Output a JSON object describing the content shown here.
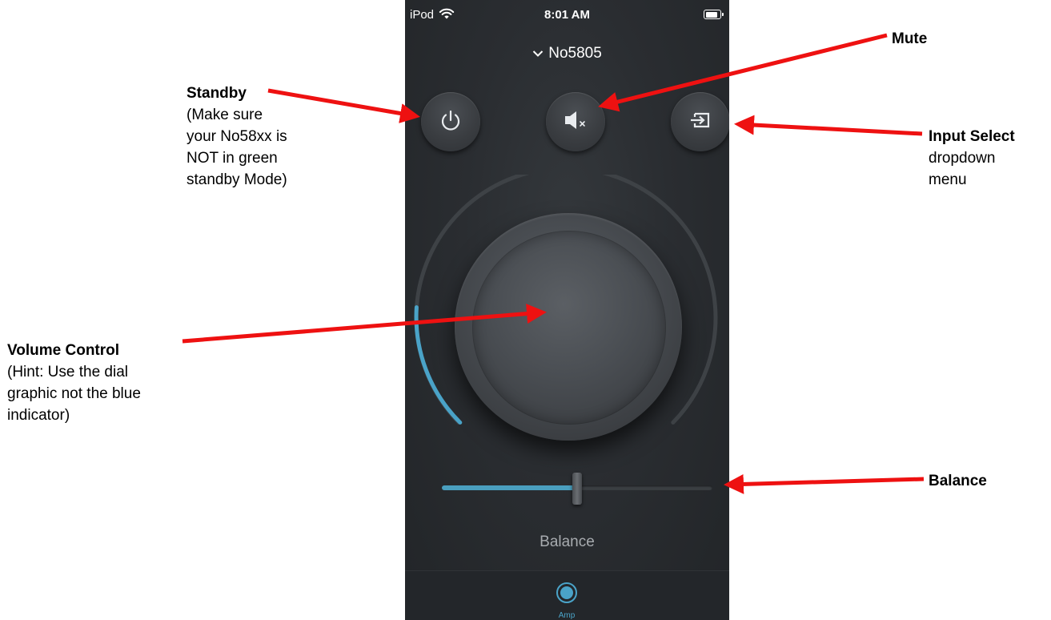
{
  "status_bar": {
    "carrier": "iPod",
    "time": "8:01 AM"
  },
  "device": {
    "title": "No5805"
  },
  "controls": {
    "standby_icon": "power-icon",
    "mute_icon": "speaker-mute-icon",
    "input_icon": "input-select-icon"
  },
  "volume": {
    "level": 0.18
  },
  "balance": {
    "label": "Balance",
    "position": 0.5
  },
  "tabbar": {
    "amp_label": "Amp"
  },
  "colors": {
    "accent": "#4aa3c8",
    "annotation_arrow": "#ee1111"
  },
  "annotations": {
    "standby": {
      "title": "Standby",
      "lines": [
        "(Make sure",
        "your No58xx is",
        "NOT in green",
        "standby Mode)"
      ]
    },
    "volume": {
      "title": "Volume Control",
      "lines": [
        "(Hint: Use the dial",
        "graphic not the blue",
        "indicator)"
      ]
    },
    "mute": {
      "title": "Mute"
    },
    "input": {
      "title": "Input Select",
      "lines": [
        "dropdown",
        "menu"
      ]
    },
    "balance": {
      "title": "Balance"
    }
  }
}
